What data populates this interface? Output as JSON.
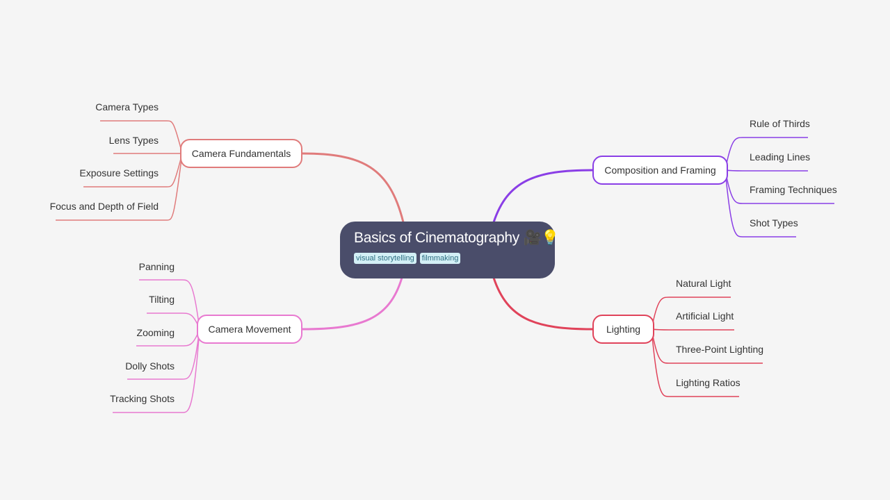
{
  "root": {
    "title": "Basics of Cinematography 🎥💡",
    "tags": [
      "visual storytelling",
      "filmmaking"
    ]
  },
  "branches": [
    {
      "id": "camera-fundamentals",
      "label": "Camera Fundamentals",
      "color": "#e07b7b",
      "side": "left",
      "children": [
        "Camera Types",
        "Lens Types",
        "Exposure Settings",
        "Focus and Depth of Field"
      ]
    },
    {
      "id": "camera-movement",
      "label": "Camera Movement",
      "color": "#e879d0",
      "side": "left",
      "children": [
        "Panning",
        "Tilting",
        "Zooming",
        "Dolly Shots",
        "Tracking Shots"
      ]
    },
    {
      "id": "composition-and-framing",
      "label": "Composition and Framing",
      "color": "#8a3ee6",
      "side": "right",
      "children": [
        "Rule of Thirds",
        "Leading Lines",
        "Framing Techniques",
        "Shot Types"
      ]
    },
    {
      "id": "lighting",
      "label": "Lighting",
      "color": "#e0435a",
      "side": "right",
      "children": [
        "Natural Light",
        "Artificial Light",
        "Three-Point Lighting",
        "Lighting Ratios"
      ]
    }
  ]
}
